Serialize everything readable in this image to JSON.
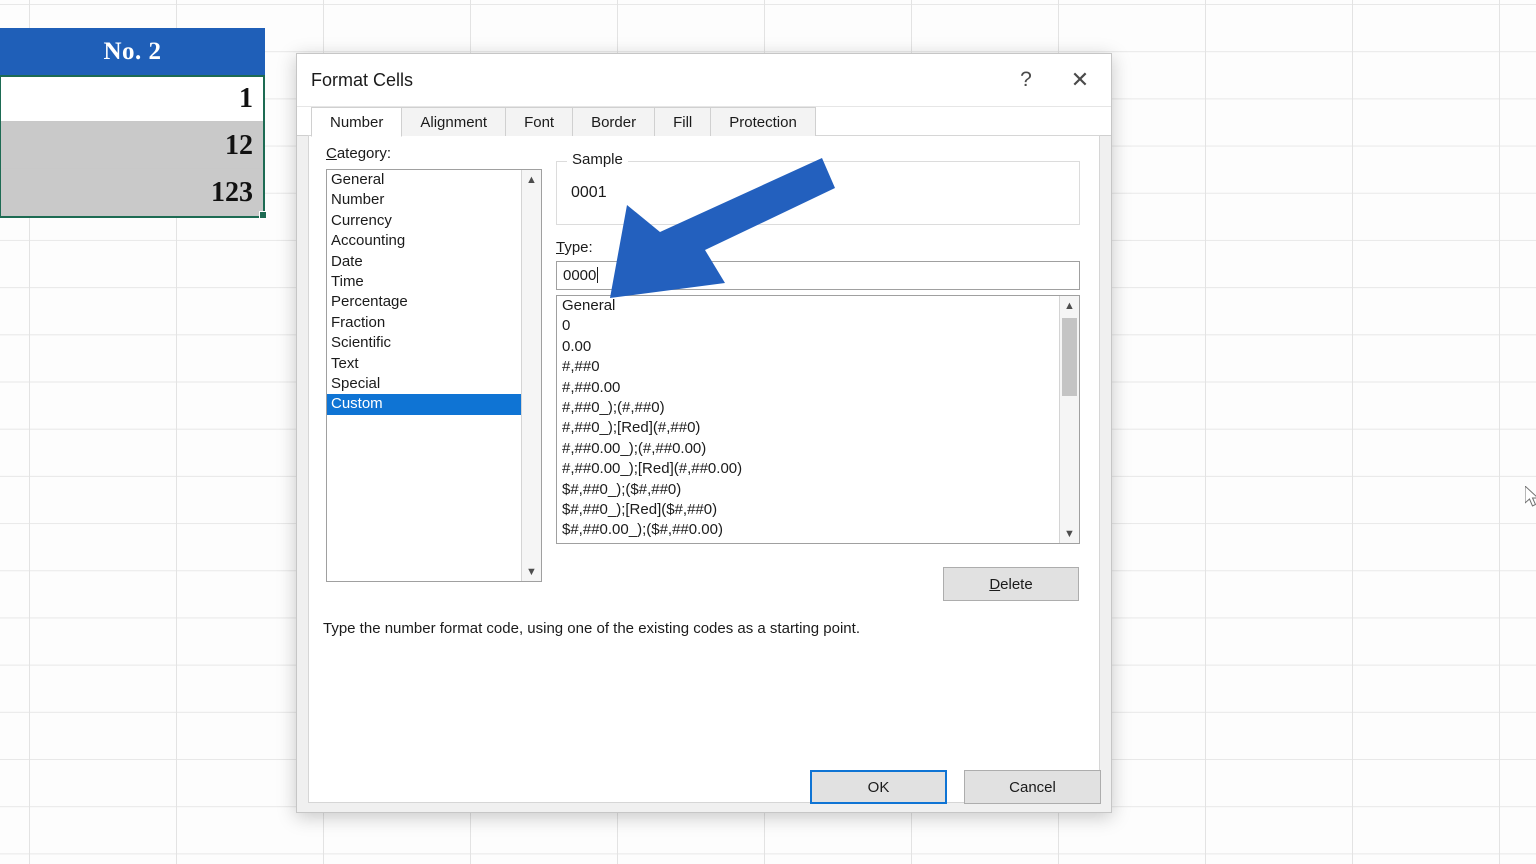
{
  "spreadsheet": {
    "header": "No. 2",
    "rows": [
      {
        "value": "1",
        "selected": false
      },
      {
        "value": "12",
        "selected": true
      },
      {
        "value": "123",
        "selected": true
      }
    ],
    "header_color": "#1f5fb8",
    "selection_border_color": "#1d6b53"
  },
  "dialog": {
    "title": "Format Cells",
    "help_icon": "question-mark-icon",
    "close_icon": "close-icon",
    "tabs": [
      {
        "label": "Number",
        "active": true
      },
      {
        "label": "Alignment",
        "active": false
      },
      {
        "label": "Font",
        "active": false
      },
      {
        "label": "Border",
        "active": false
      },
      {
        "label": "Fill",
        "active": false
      },
      {
        "label": "Protection",
        "active": false
      }
    ],
    "category": {
      "label_prefix": "C",
      "label_rest": "ategory:",
      "items": [
        "General",
        "Number",
        "Currency",
        "Accounting",
        "Date",
        "Time",
        "Percentage",
        "Fraction",
        "Scientific",
        "Text",
        "Special",
        "Custom"
      ],
      "selected": "Custom",
      "selected_color": "#0f74d4"
    },
    "sample": {
      "legend": "Sample",
      "value": "0001"
    },
    "type_field": {
      "label_prefix": "T",
      "label_rest": "ype:",
      "value": "0000"
    },
    "type_list": [
      "General",
      "0",
      "0.00",
      "#,##0",
      "#,##0.00",
      "#,##0_);(#,##0)",
      "#,##0_);[Red](#,##0)",
      "#,##0.00_);(#,##0.00)",
      "#,##0.00_);[Red](#,##0.00)",
      "$#,##0_);($#,##0)",
      "$#,##0_);[Red]($#,##0)",
      "$#,##0.00_);($#,##0.00)"
    ],
    "delete_button": {
      "label_prefix": "D",
      "label_rest": "elete"
    },
    "hint": "Type the number format code, using one of the existing codes as a starting point.",
    "ok_button": "OK",
    "cancel_button": "Cancel",
    "focus_color": "#0f74d4"
  },
  "annotation": {
    "arrow_color": "#2360be",
    "arrow_points_to": "type-input"
  }
}
